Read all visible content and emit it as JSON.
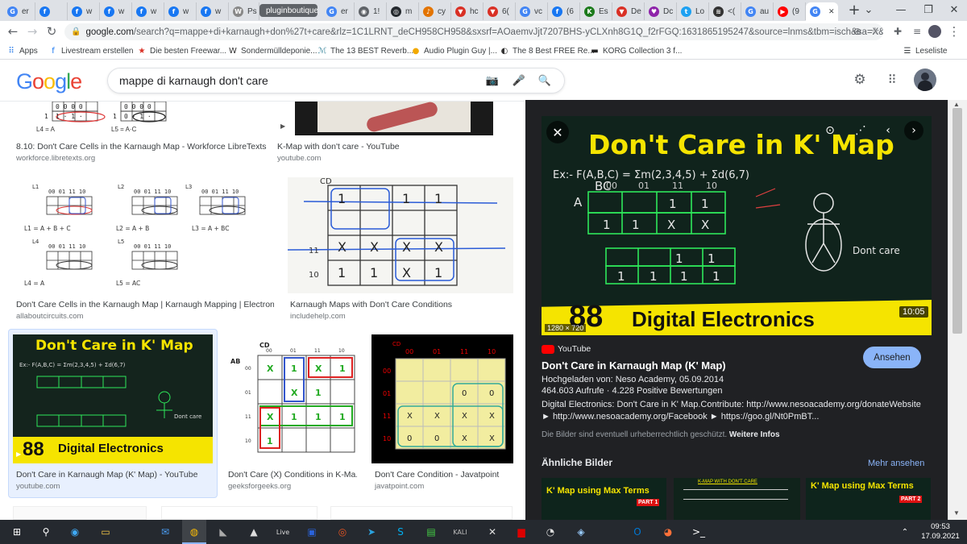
{
  "browser": {
    "tabs": [
      {
        "label": "er",
        "icon": "google-icon"
      },
      {
        "label": "",
        "icon": "facebook-icon"
      },
      {
        "label": "w",
        "icon": "facebook-icon"
      },
      {
        "label": "w",
        "icon": "facebook-icon"
      },
      {
        "label": "w",
        "icon": "facebook-icon"
      },
      {
        "label": "w",
        "icon": "facebook-icon"
      },
      {
        "label": "w",
        "icon": "facebook-icon"
      },
      {
        "label": "Ps",
        "icon": "wikipedia-icon"
      },
      {
        "label": "pluginboutique",
        "icon": "tab-group"
      },
      {
        "label": "er",
        "icon": "google-icon"
      },
      {
        "label": "1!",
        "icon": "globe-icon"
      },
      {
        "label": "m",
        "icon": "github-icon"
      },
      {
        "label": "cy",
        "icon": "plugin-icon"
      },
      {
        "label": "hc",
        "icon": "shield-icon"
      },
      {
        "label": "6(",
        "icon": "shield-icon"
      },
      {
        "label": "vc",
        "icon": "google-icon"
      },
      {
        "label": "(6",
        "icon": "facebook-icon"
      },
      {
        "label": "Es",
        "icon": "km-icon"
      },
      {
        "label": "De",
        "icon": "shield-icon"
      },
      {
        "label": "Dc",
        "icon": "heart-icon"
      },
      {
        "label": "Lo",
        "icon": "twitter-icon"
      },
      {
        "label": "<(",
        "icon": "stream-icon"
      },
      {
        "label": "au",
        "icon": "google-icon"
      },
      {
        "label": "(9",
        "icon": "youtube-icon"
      },
      {
        "label": "",
        "icon": "google-icon"
      }
    ],
    "url_main": "google.com",
    "url_rest": "/search?q=mappe+di+karnaugh+don%27t+care&rlz=1C1LRNT_deCH958CH958&sxsrf=AOaemvJjt7207BHS-yCLXnh8G1Q_f2rFGQ:1631865195247&source=lnms&tbm=isch&sa=X&ved=2a...",
    "bookmarks": [
      {
        "label": "Apps",
        "icon": "apps-grid-icon"
      },
      {
        "label": "Livestream erstellen",
        "icon": "facebook-icon"
      },
      {
        "label": "Die besten Freewar...",
        "icon": "star-icon"
      },
      {
        "label": "Sondermülldeponie...",
        "icon": "w-icon"
      },
      {
        "label": "The 13 BEST Reverb...",
        "icon": "reverb-icon"
      },
      {
        "label": "Audio Plugin Guy |...",
        "icon": "plugin-guy-icon"
      },
      {
        "label": "The 8 Best FREE Re...",
        "icon": "c-icon"
      },
      {
        "label": "KORG Collection 3 f...",
        "icon": "korg-icon"
      }
    ],
    "reading_list": "Leseliste"
  },
  "google": {
    "logo": "Google",
    "query": "mappe di karnaugh don't care"
  },
  "results": [
    {
      "caption": "8.10: Don't Care Cells in the Karnaugh Map - Workforce LibreTexts",
      "source": "workforce.libretexts.org"
    },
    {
      "caption": "K-Map with don't care - YouTube",
      "source": "youtube.com"
    },
    {
      "caption": "Don't Care Cells in the Karnaugh Map | Karnaugh Mapping | Electroni...",
      "source": "allaboutcircuits.com"
    },
    {
      "caption": "Karnaugh Maps with Don't Care Conditions",
      "source": "includehelp.com"
    },
    {
      "caption": "Don't Care in Karnaugh Map (K' Map) - YouTube",
      "source": "youtube.com"
    },
    {
      "caption": "Don't Care (X) Conditions in K-Ma...",
      "source": "geeksforgeeks.org"
    },
    {
      "caption": "Don't Care Condition - Javatpoint",
      "source": "javatpoint.com"
    }
  ],
  "thumbs": {
    "libretexts": {
      "l4": "L4 = A",
      "l5": "L5 = A·C"
    },
    "allabout": {
      "maps": [
        "L1",
        "L2",
        "L3",
        "L4",
        "L5"
      ],
      "equations": [
        "L1 = A + B + C",
        "L2 = A + B",
        "L3 = A + BC",
        "L4 = A",
        "L5 = AC"
      ],
      "header": "00 01 11 10"
    },
    "gfg": {
      "corner_top": "CD",
      "corner_left": "AB",
      "cols": [
        "00",
        "01",
        "11",
        "10"
      ],
      "rows": [
        "00",
        "01",
        "11",
        "10"
      ]
    },
    "javat": {
      "corner": "CD",
      "cols": [
        "00",
        "01",
        "11",
        "10"
      ],
      "rows": [
        "00",
        "01",
        "11",
        "10"
      ],
      "row1": [
        "",
        "",
        "",
        ""
      ],
      "row2": [
        "",
        "",
        "0",
        "0"
      ],
      "row3": [
        "X",
        "X",
        "X",
        "X"
      ],
      "row4": [
        "0",
        "0",
        "X",
        "X"
      ]
    },
    "neso_small": {
      "title": "Don't Care in K' Map",
      "banner_num": "88",
      "banner": "Digital Electronics"
    }
  },
  "panel": {
    "video_title_big": "Don't Care in K' Map",
    "equation": "Ex:- F(A,B,C) = Σm(2,3,4,5) + Σd(6,7)",
    "dont_care_note": "Dont care",
    "banner_num": "88",
    "banner_text": "Digital Electronics",
    "duration": "10:05",
    "dimensions": "1280 × 720",
    "source": "YouTube",
    "title": "Don't Care in Karnaugh Map (K' Map)",
    "uploaded": "Hochgeladen von: Neso Academy, 05.09.2014",
    "views": "464.603 Aufrufe · 4.228 Positive Bewertungen",
    "description": "Digital Electronics: Don't Care in K' Map.Contribute: http://www.nesoacademy.org/donateWebsite ► http://www.nesoacademy.org/Facebook ► https://goo.gl/Nt0PmBT...",
    "copyright": "Die Bilder sind eventuell urheberrechtlich geschützt.",
    "more_info": "Weitere Infos",
    "visit_button": "Ansehen",
    "similar_heading": "Ähnliche Bilder",
    "see_more": "Mehr ansehen",
    "similar": [
      {
        "title": "K' Map using Max Terms",
        "part": "PART 1"
      },
      {
        "title": "K-MAP WITH DON'T CARE",
        "part": ""
      },
      {
        "title": "K' Map using Max Terms",
        "part": "PART 2"
      }
    ]
  },
  "taskbar": {
    "time": "09:53",
    "date": "17.09.2021"
  },
  "colors": {
    "google_blue": "#4285f4",
    "google_red": "#ea4335",
    "google_yellow": "#fbbc05",
    "google_green": "#34a853",
    "neso_yellow": "#f5e400",
    "panel_bg": "#202124"
  }
}
